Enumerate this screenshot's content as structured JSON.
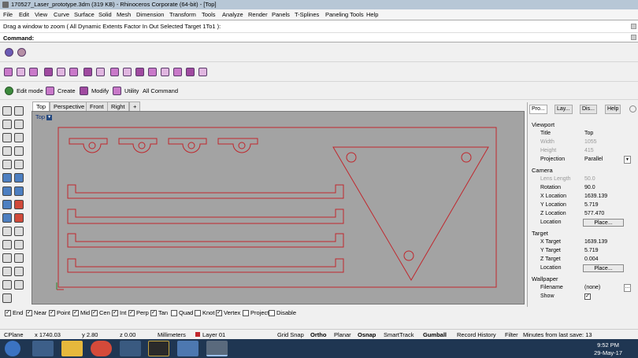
{
  "window": {
    "title": "170527_Laser_prototype.3dm (319 KB) - Rhinoceros Corporate (64-bit) - [Top]"
  },
  "menu": [
    "File",
    "Edit",
    "View",
    "Curve",
    "Surface",
    "Solid",
    "Mesh",
    "Dimension",
    "Transform",
    "Tools",
    "Analyze",
    "Render",
    "Panels",
    "T-Splines",
    "Paneling Tools",
    "Help"
  ],
  "command": {
    "history": "Drag a window to zoom ( All  Dynamic  Extents  Factor  In  Out  Selected  Target  1To1 ):",
    "prompt": "Command:"
  },
  "toolbar_main": {
    "edit_mode": "Edit mode",
    "create": "Create",
    "modify": "Modify",
    "utility": "Utility",
    "all_command": "All Command"
  },
  "viewport_tabs": [
    "Top",
    "Perspective",
    "Front",
    "Right",
    "+"
  ],
  "viewport": {
    "label": "Top",
    "curve_color": "#c0272d",
    "bg_color": "#a3a3a3"
  },
  "osnap": [
    {
      "label": "End",
      "on": true
    },
    {
      "label": "Near",
      "on": true
    },
    {
      "label": "Point",
      "on": true
    },
    {
      "label": "Mid",
      "on": true
    },
    {
      "label": "Cen",
      "on": true
    },
    {
      "label": "Int",
      "on": true
    },
    {
      "label": "Perp",
      "on": true
    },
    {
      "label": "Tan",
      "on": true
    },
    {
      "label": "Quad",
      "on": false
    },
    {
      "label": "Knot",
      "on": false
    },
    {
      "label": "Vertex",
      "on": true
    },
    {
      "label": "Project",
      "on": false
    },
    {
      "label": "Disable",
      "on": false
    }
  ],
  "status": {
    "cplane": "CPlane",
    "x": "x 1740.03",
    "y": "y 2.80",
    "z": "z 0.00",
    "units": "Millimeters",
    "layer": "Layer 01",
    "grid_snap": "Grid Snap",
    "ortho": "Ortho",
    "planar": "Planar",
    "osnap": "Osnap",
    "smarttrack": "SmartTrack",
    "gumball": "Gumball",
    "record_history": "Record History",
    "filter": "Filter",
    "last_save": "Minutes from last save: 13"
  },
  "panel": {
    "tabs": [
      "Pro...",
      "Lay...",
      "Dis...",
      "Help"
    ],
    "viewport_section": "Viewport",
    "title_k": "Title",
    "title_v": "Top",
    "width_k": "Width",
    "width_v": "1055",
    "height_k": "Height",
    "height_v": "415",
    "projection_k": "Projection",
    "projection_v": "Parallel",
    "camera_section": "Camera",
    "lens_k": "Lens Length",
    "lens_v": "50.0",
    "rotation_k": "Rotation",
    "rotation_v": "90.0",
    "xloc_k": "X Location",
    "xloc_v": "1639.139",
    "yloc_k": "Y Location",
    "yloc_v": "5.719",
    "zloc_k": "Z Location",
    "zloc_v": "577.470",
    "location_k": "Location",
    "place_label": "Place...",
    "target_section": "Target",
    "xt_k": "X Target",
    "xt_v": "1639.139",
    "yt_k": "Y Target",
    "yt_v": "5.719",
    "zt_k": "Z Target",
    "zt_v": "0.004",
    "tloc_k": "Location",
    "tplace_label": "Place...",
    "wallpaper_section": "Wallpaper",
    "filename_k": "Filename",
    "filename_v": "(none)",
    "show_k": "Show"
  },
  "taskbar": {
    "time": "9:52 PM",
    "date": "29-May-17"
  }
}
